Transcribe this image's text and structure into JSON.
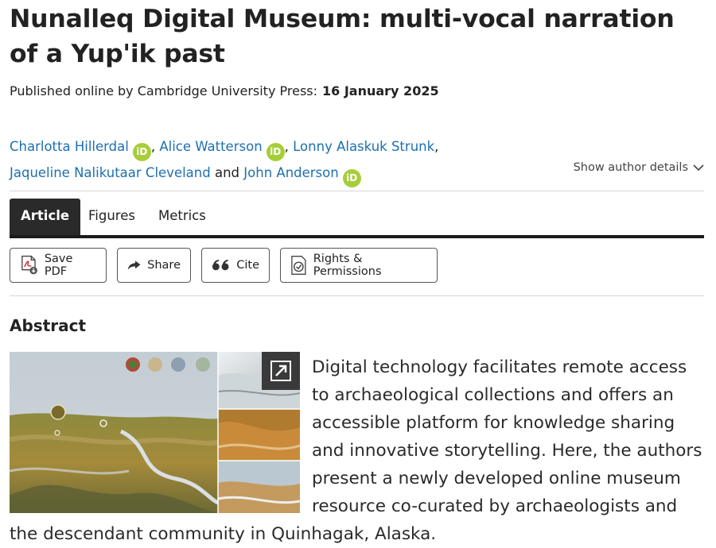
{
  "article": {
    "title": "Nunalleq Digital Museum: multi-vocal narration of a Yup'ik past",
    "published_prefix": "Published online by Cambridge University Press:",
    "published_date": "16 January 2025"
  },
  "authors": [
    {
      "name": "Charlotta Hillerdal",
      "orcid": true
    },
    {
      "name": "Alice Watterson",
      "orcid": true
    },
    {
      "name": "Lonny Alaskuk Strunk",
      "orcid": false
    },
    {
      "name": "Jaqueline Nalikutaar Cleveland",
      "orcid": false
    },
    {
      "name": "John Anderson",
      "orcid": true
    }
  ],
  "author_separators": {
    "comma": ",",
    "and": "and"
  },
  "orcid_label": "iD",
  "show_author_details": "Show author details",
  "tabs": [
    {
      "label": "Article",
      "active": true
    },
    {
      "label": "Figures",
      "active": false
    },
    {
      "label": "Metrics",
      "active": false
    }
  ],
  "actions": {
    "save_pdf": "Save PDF",
    "share": "Share",
    "cite": "Cite",
    "rights": "Rights & Permissions"
  },
  "abstract": {
    "heading": "Abstract",
    "text": "Digital technology facilitates remote access to archaeological collections and offers an accessible platform for knowledge sharing and innovative storytelling. Here, the authors present a newly developed online museum resource co-curated by archaeologists and the descendant community in Quinhagak, Alaska."
  },
  "colors": {
    "link": "#1d6fb0",
    "orcid": "#a6ce39",
    "active_tab": "#2a2a2a",
    "pdf_red": "#d4252a"
  },
  "icons": [
    "orcid-icon",
    "chevron-down-icon",
    "pdf-icon",
    "share-icon",
    "quote-icon",
    "rights-icon",
    "expand-icon"
  ]
}
